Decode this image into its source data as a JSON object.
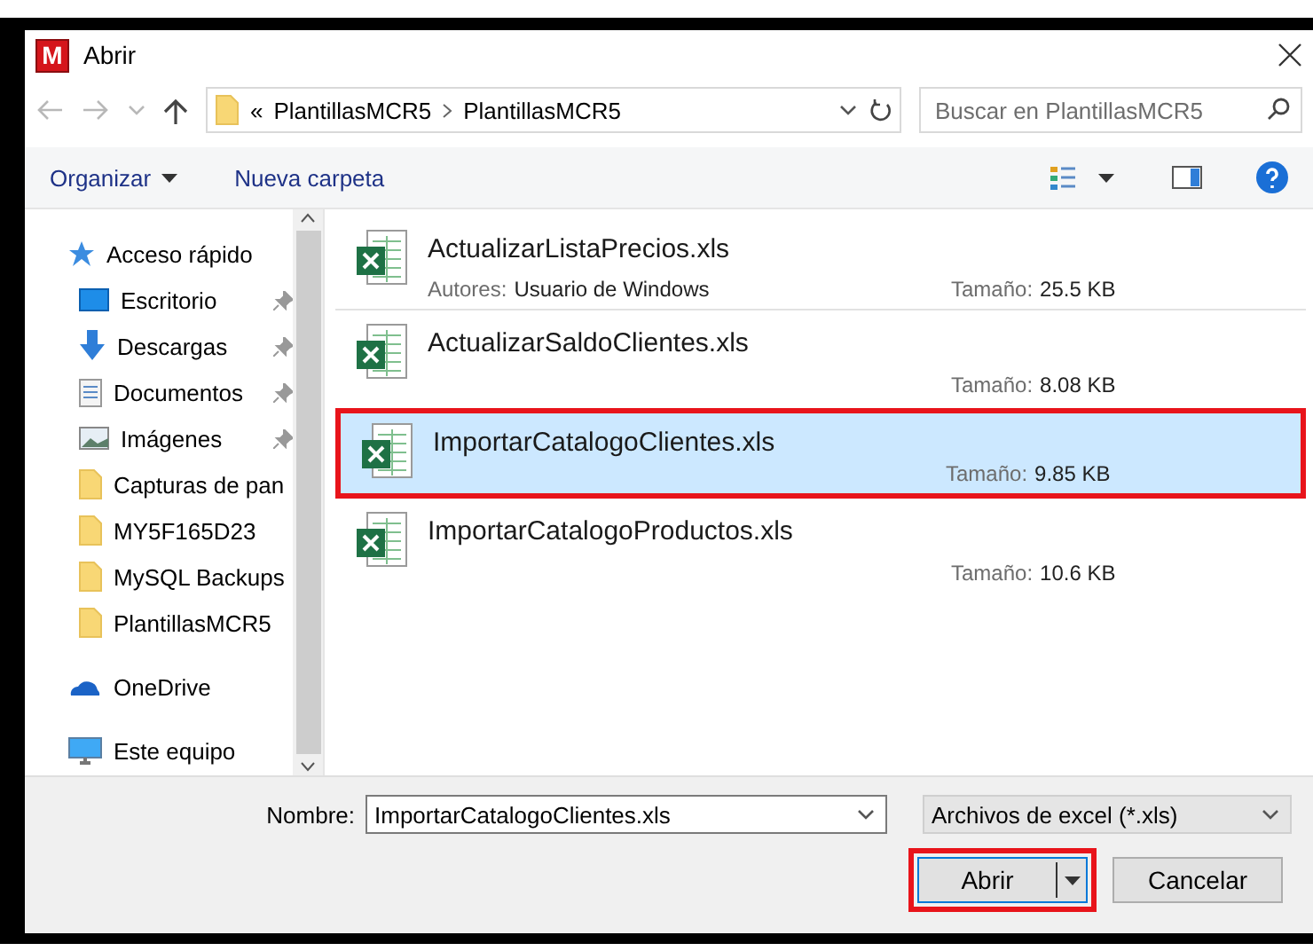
{
  "window": {
    "app_logo": "M",
    "title": "Abrir"
  },
  "address_bar": {
    "prefix": "«",
    "path": [
      "PlantillasMCR5",
      "PlantillasMCR5"
    ]
  },
  "search": {
    "placeholder": "Buscar en PlantillasMCR5"
  },
  "toolbar": [
    {
      "label": "Organizar",
      "dropdown": true
    },
    {
      "label": "Nueva carpeta",
      "dropdown": false
    }
  ],
  "sidebar": {
    "items": [
      {
        "label": "Acceso rápido",
        "kind": "star",
        "children": [
          {
            "label": "Escritorio",
            "kind": "desktop",
            "pinned": true
          },
          {
            "label": "Descargas",
            "kind": "download",
            "pinned": true
          },
          {
            "label": "Documentos",
            "kind": "document",
            "pinned": true
          },
          {
            "label": "Imágenes",
            "kind": "image",
            "pinned": true
          },
          {
            "label": "Capturas de pan",
            "kind": "folder",
            "pinned": false
          },
          {
            "label": "MY5F165D23",
            "kind": "folder",
            "pinned": false
          },
          {
            "label": "MySQL Backups",
            "kind": "folder",
            "pinned": false
          },
          {
            "label": "PlantillasMCR5",
            "kind": "folder",
            "pinned": false
          }
        ]
      },
      {
        "label": "OneDrive",
        "kind": "cloud"
      },
      {
        "label": "Este equipo",
        "kind": "computer"
      }
    ]
  },
  "files": [
    {
      "name": "ActualizarListaPrecios.xls",
      "authors_label": "Autores:",
      "authors": "Usuario de Windows",
      "size_label": "Tamaño:",
      "size": "25.5 KB",
      "selected": false,
      "highlighted": false
    },
    {
      "name": "ActualizarSaldoClientes.xls",
      "size_label": "Tamaño:",
      "size": "8.08 KB",
      "selected": false,
      "highlighted": false
    },
    {
      "name": "ImportarCatalogoClientes.xls",
      "size_label": "Tamaño:",
      "size": "9.85 KB",
      "selected": true,
      "highlighted": true
    },
    {
      "name": "ImportarCatalogoProductos.xls",
      "size_label": "Tamaño:",
      "size": "10.6 KB",
      "selected": false,
      "highlighted": false
    }
  ],
  "filename": {
    "label": "Nombre:",
    "value": "ImportarCatalogoClientes.xls"
  },
  "filetype": {
    "value": "Archivos de excel (*.xls)"
  },
  "buttons": [
    {
      "label": "Abrir",
      "kind": "split",
      "highlighted": true
    },
    {
      "label": "Cancelar",
      "kind": "plain",
      "highlighted": false
    }
  ]
}
